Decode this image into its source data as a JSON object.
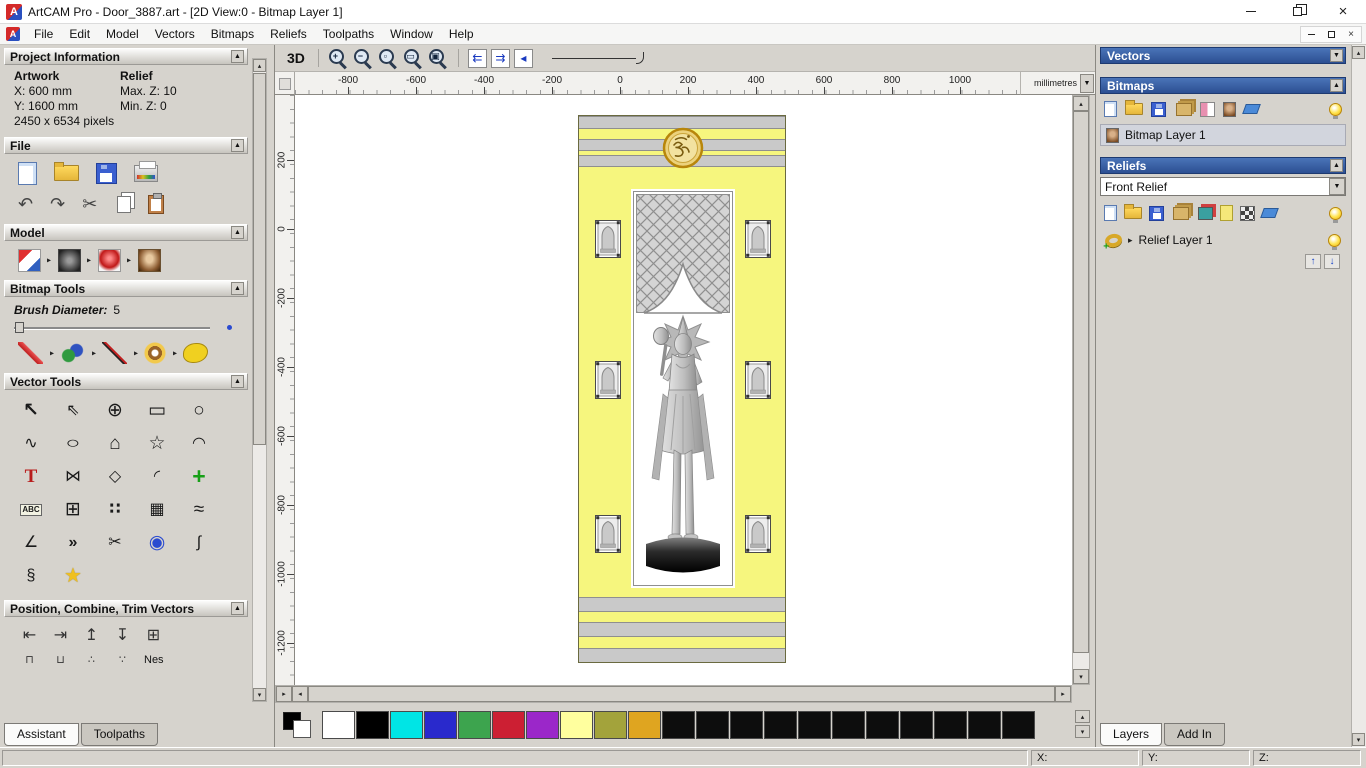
{
  "ui": {
    "up": "▲",
    "down": "▼",
    "left": "◀",
    "right": "▶",
    "small_up": "▴",
    "small_down": "▾",
    "small_left": "◂",
    "small_right": "▸",
    "close": "×",
    "up_arrow": "↑",
    "down_arrow": "↓",
    "expand": "▸"
  },
  "window": {
    "app_icon_letter": "A",
    "title": "ArtCAM Pro - Door_3887.art - [2D View:0 - Bitmap Layer 1]"
  },
  "menubar": {
    "items": [
      "File",
      "Edit",
      "Model",
      "Vectors",
      "Bitmaps",
      "Reliefs",
      "Toolpaths",
      "Window",
      "Help"
    ]
  },
  "toolbar": {
    "view3d_label": "3D",
    "zoom_icons": [
      {
        "name": "zoom-in-icon",
        "sym": "+"
      },
      {
        "name": "zoom-out-icon",
        "sym": "−"
      },
      {
        "name": "zoom-window-icon",
        "sym": "▫"
      },
      {
        "name": "zoom-page-icon",
        "sym": "▭"
      },
      {
        "name": "zoom-objects-icon",
        "sym": "▣"
      }
    ],
    "nav_icons": [
      {
        "n": "pan-left-icon",
        "g": "⇇",
        "c": "ic-pgarr"
      },
      {
        "n": "pan-right-icon",
        "g": "⇉",
        "c": "ic-pgarr"
      },
      {
        "n": "zoom-previous-icon",
        "g": "◂",
        "c": "ic-pgarr"
      }
    ]
  },
  "ruler": {
    "h_ticks": [
      "-800",
      "-600",
      "-400",
      "-200",
      "0",
      "200",
      "400",
      "600",
      "800",
      "1000"
    ],
    "v_ticks": [
      "200",
      "0",
      "-200",
      "-400",
      "-600",
      "-800",
      "-1000",
      "-1200"
    ],
    "units_label": "millimetres"
  },
  "left_panel": {
    "project_information": {
      "title": "Project Information",
      "artwork_header": "Artwork",
      "relief_header": "Relief",
      "x": "X: 600 mm",
      "y": "Y: 1600 mm",
      "max_z": "Max. Z: 10",
      "min_z": "Min. Z: 0",
      "pixels": "2450 x 6534 pixels"
    },
    "file": {
      "title": "File",
      "row1": [
        {
          "n": "new-model-icon",
          "c": "ic-page lg"
        },
        {
          "n": "open-model-icon",
          "c": "ic-folder lg"
        },
        {
          "n": "save-model-icon",
          "c": "ic-disk lg"
        },
        {
          "n": "print-icon",
          "c": "ic-print"
        }
      ],
      "row2": [
        {
          "n": "undo-icon",
          "g": "↶"
        },
        {
          "n": "redo-icon",
          "g": "↷"
        },
        {
          "n": "cut-icon",
          "g": "✂"
        },
        {
          "n": "copy-icon",
          "c": "ic-copy"
        },
        {
          "n": "paste-icon",
          "c": "ic-paste"
        }
      ]
    },
    "model": {
      "title": "Model",
      "icons": [
        {
          "n": "set-model-size-icon",
          "c": "ic-msize drop"
        },
        {
          "n": "greyscale-image-icon",
          "c": "ic-mgrey drop"
        },
        {
          "n": "lighting-icon",
          "c": "ic-mlight drop"
        },
        {
          "n": "texture-image-icon",
          "c": "ic-mtex"
        }
      ]
    },
    "bitmap_tools": {
      "title": "Bitmap Tools",
      "brush_label": "Brush Diameter:",
      "brush_value": "5",
      "icons": [
        {
          "n": "paint-brush-icon",
          "c": "ic-brush drop"
        },
        {
          "n": "colour-palette-icon",
          "c": "ic-pal drop"
        },
        {
          "n": "draw-pencil-icon",
          "c": "ic-pencil drop"
        },
        {
          "n": "flood-fill-icon",
          "c": "ic-donut drop"
        },
        {
          "n": "eraser-icon",
          "c": "ic-blob"
        }
      ]
    },
    "vector_tools": {
      "title": "Vector Tools",
      "icons": [
        {
          "n": "select-tool-icon",
          "g": "↖",
          "c": "c-b c-lg"
        },
        {
          "n": "node-editing-tool-icon",
          "g": "⇖",
          "c": ""
        },
        {
          "n": "transform-tool-icon",
          "g": "⊕",
          "c": "c-lg"
        },
        {
          "n": "rectangle-tool-icon",
          "g": "▭",
          "c": "c-lg"
        },
        {
          "n": "circle-tool-icon",
          "g": "○",
          "c": "c-lg"
        },
        {
          "n": "freehand-draw-tool-icon",
          "g": "∿",
          "c": ""
        },
        {
          "n": "ellipse-tool-icon",
          "g": "○",
          "c": "c-ell"
        },
        {
          "n": "polygon-tool-icon",
          "g": "⌂",
          "c": "c-lg"
        },
        {
          "n": "star-tool-icon",
          "g": "☆",
          "c": "c-lg"
        },
        {
          "n": "arc-tool-icon",
          "g": "◠",
          "c": ""
        },
        {
          "n": "text-tool-icon",
          "g": "T",
          "c": "c-red"
        },
        {
          "n": "mirror-tool-icon",
          "g": "⋈",
          "c": ""
        },
        {
          "n": "offset-tool-icon",
          "g": "◇",
          "c": ""
        },
        {
          "n": "fillet-tool-icon",
          "g": "◜",
          "c": "c-b"
        },
        {
          "n": "paste-along-curve-tool-icon",
          "g": "+",
          "c": "c-green"
        },
        {
          "n": "text-block-tool-icon",
          "g": "ABC",
          "c": "c-abc"
        },
        {
          "n": "grid-tool-icon",
          "g": "⊞",
          "c": "c-lg"
        },
        {
          "n": "block-copy-tool-icon",
          "g": "∷",
          "c": "c-b"
        },
        {
          "n": "nesting-tool-icon",
          "g": "▦",
          "c": ""
        },
        {
          "n": "fit-curve-tool-icon",
          "g": "≈",
          "c": "c-lg"
        },
        {
          "n": "bisector-tool-icon",
          "g": "∠",
          "c": ""
        },
        {
          "n": "join-vectors-tool-icon",
          "g": "»",
          "c": "c-b"
        },
        {
          "n": "trim-tool-icon",
          "g": "✂",
          "c": ""
        },
        {
          "n": "extrude-tool-icon",
          "g": "◉",
          "c": "c-blue"
        },
        {
          "n": "spline-tool-icon",
          "g": "∫",
          "c": ""
        },
        {
          "n": "section-tool-icon",
          "g": "§",
          "c": ""
        },
        {
          "n": "wrap-tool-icon",
          "g": "★",
          "c": "c-yellow"
        }
      ]
    },
    "position_tools": {
      "title": "Position, Combine, Trim Vectors",
      "row1": [
        {
          "n": "align-left-icon",
          "g": "⇤"
        },
        {
          "n": "align-right-icon",
          "g": "⇥"
        },
        {
          "n": "align-top-icon",
          "g": "↥"
        },
        {
          "n": "align-bottom-icon",
          "g": "↧"
        },
        {
          "n": "align-centre-icon",
          "g": "⊞"
        }
      ],
      "row2": [
        {
          "n": "weld-vectors-icon",
          "g": "⊓"
        },
        {
          "n": "subtract-vectors-icon",
          "g": "⊔"
        },
        {
          "n": "slice-vectors-icon",
          "g": "∴"
        },
        {
          "n": "array-copy-icon",
          "g": "∵"
        }
      ],
      "nes_label": "Nes"
    },
    "tabs": [
      {
        "label": "Assistant",
        "active": true
      },
      {
        "label": "Toolpaths",
        "active": false
      }
    ]
  },
  "right_panel": {
    "vectors": {
      "title": "Vectors"
    },
    "bitmaps": {
      "title": "Bitmaps",
      "icons": [
        {
          "n": "new-bitmap-layer-icon",
          "c": "ic-page"
        },
        {
          "n": "open-bitmap-icon",
          "c": "ic-folder"
        },
        {
          "n": "save-bitmap-icon",
          "c": "ic-disk"
        },
        {
          "n": "duplicate-bitmap-icon",
          "c": "ic-stack"
        },
        {
          "n": "merge-bitmap-icon",
          "c": "ic-merge"
        },
        {
          "n": "bitmap-preview-icon",
          "c": "ic-thumb"
        },
        {
          "n": "delete-bitmap-icon",
          "c": "ic-eraser"
        }
      ],
      "layer_name": "Bitmap Layer 1"
    },
    "reliefs": {
      "title": "Reliefs",
      "selected_relief": "Front Relief",
      "icons": [
        {
          "n": "new-relief-layer-icon",
          "c": "ic-page"
        },
        {
          "n": "open-relief-icon",
          "c": "ic-folder"
        },
        {
          "n": "save-relief-icon",
          "c": "ic-disk"
        },
        {
          "n": "duplicate-relief-icon",
          "c": "ic-stack"
        },
        {
          "n": "relief-layer-stack-icon",
          "c": "ic-layers"
        },
        {
          "n": "relief-sheet-icon",
          "c": "ic-sheet"
        },
        {
          "n": "relief-preview-icon",
          "c": "ic-checker"
        },
        {
          "n": "delete-relief-icon",
          "c": "ic-eraser"
        }
      ],
      "layer_name": "Relief Layer 1"
    },
    "tabs": [
      {
        "label": "Layers",
        "active": true
      },
      {
        "label": "Add In",
        "active": false
      }
    ]
  },
  "palette": {
    "colors": [
      "#ffffff",
      "#000000",
      "#00e5e5",
      "#2929cc",
      "#3da44e",
      "#cc1f33",
      "#9b27c9",
      "#ffff9e",
      "#a3a33b",
      "#dfa520",
      "#0d0d0d",
      "#0d0d0d",
      "#0d0d0d",
      "#0d0d0d",
      "#0d0d0d",
      "#0d0d0d",
      "#0d0d0d",
      "#0d0d0d",
      "#0d0d0d",
      "#0d0d0d",
      "#0d0d0d"
    ]
  },
  "statusbar": {
    "x_label": "X:",
    "y_label": "Y:",
    "z_label": "Z:"
  }
}
